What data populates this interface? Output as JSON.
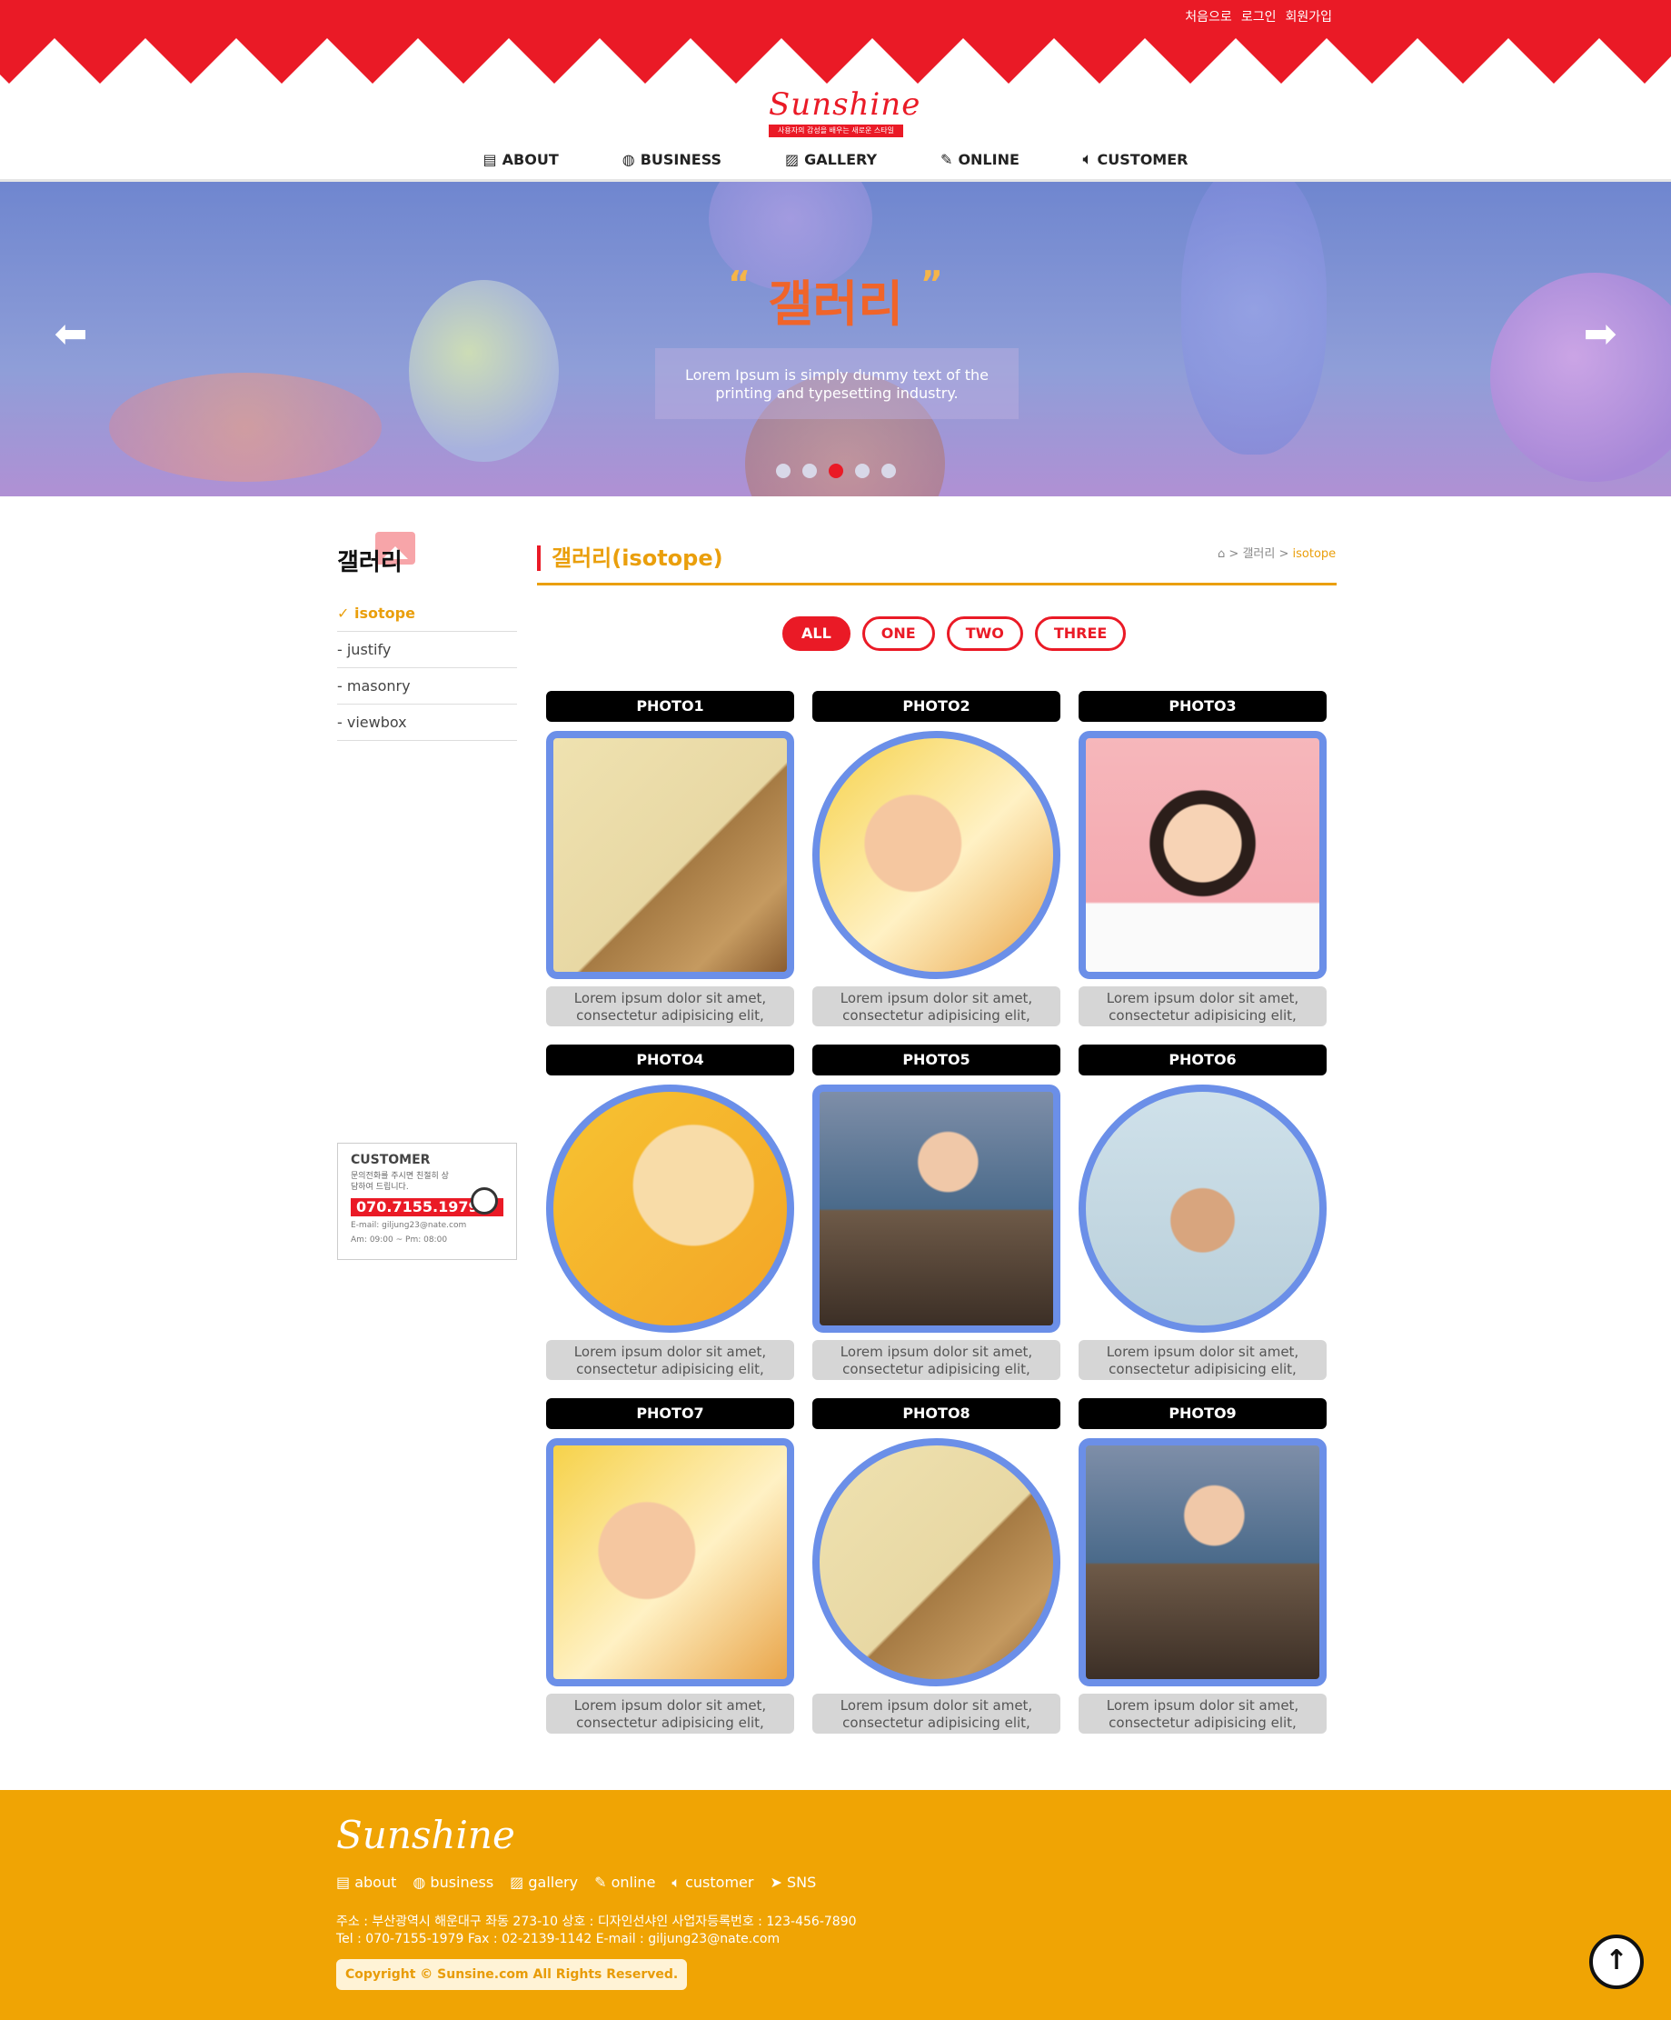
{
  "header": {
    "top_links": [
      "처음으로",
      "로그인",
      "회원가입"
    ],
    "logo_text": "Sunshine",
    "logo_tagline": "사용자의 감성을 배우는 새로운 스타일",
    "nav": [
      {
        "label": "ABOUT",
        "icon": "building-icon"
      },
      {
        "label": "BUSINESS",
        "icon": "globe-icon"
      },
      {
        "label": "GALLERY",
        "icon": "image-icon"
      },
      {
        "label": "ONLINE",
        "icon": "edit-icon"
      },
      {
        "label": "CUSTOMER",
        "icon": "speaker-icon"
      }
    ],
    "brand_color": "#ea1a26"
  },
  "hero": {
    "title": "갤러리",
    "text": "Lorem Ipsum is simply dummy text of the printing and typesetting industry.",
    "slide_count": 5,
    "active_slide": 3
  },
  "sidebar": {
    "title": "갤러리",
    "items": [
      "✓ isotope",
      "- justify",
      "- masonry",
      "- viewbox"
    ],
    "active_index": 0,
    "customer": {
      "title": "CUSTOMER",
      "desc": "문의전화를 주시면 친절히 상담하여 드립니다.",
      "phone": "070.7155.1979",
      "email": "E-mail: giljung23@nate.com",
      "hours": "Am: 09:00 ~ Pm: 08:00"
    }
  },
  "content": {
    "title": "갤러리(isotope)",
    "breadcrumb": {
      "separator": ">",
      "section": "갤러리",
      "current": "isotope"
    },
    "filters": [
      "ALL",
      "ONE",
      "TWO",
      "THREE"
    ],
    "active_filter": 0,
    "accent_color": "#ea9f0c",
    "gallery": [
      {
        "title": "PHOTO1",
        "desc": "Lorem ipsum dolor sit amet, consectetur adipisicing elit,"
      },
      {
        "title": "PHOTO2",
        "desc": "Lorem ipsum dolor sit amet, consectetur adipisicing elit,"
      },
      {
        "title": "PHOTO3",
        "desc": "Lorem ipsum dolor sit amet, consectetur adipisicing elit,"
      },
      {
        "title": "PHOTO4",
        "desc": "Lorem ipsum dolor sit amet, consectetur adipisicing elit,"
      },
      {
        "title": "PHOTO5",
        "desc": "Lorem ipsum dolor sit amet, consectetur adipisicing elit,"
      },
      {
        "title": "PHOTO6",
        "desc": "Lorem ipsum dolor sit amet, consectetur adipisicing elit,"
      },
      {
        "title": "PHOTO7",
        "desc": "Lorem ipsum dolor sit amet, consectetur adipisicing elit,"
      },
      {
        "title": "PHOTO8",
        "desc": "Lorem ipsum dolor sit amet, consectetur adipisicing elit,"
      },
      {
        "title": "PHOTO9",
        "desc": "Lorem ipsum dolor sit amet, consectetur adipisicing elit,"
      }
    ]
  },
  "footer": {
    "logo_text": "Sunshine",
    "menu": [
      "about",
      "business",
      "gallery",
      "online",
      "customer",
      "SNS"
    ],
    "address": "주소 : 부산광역시 해운대구 좌동 273-10    상호 : 디자인선샤인    사업자등록번호 : 123-456-7890",
    "contact": "Tel : 070-7155-1979    Fax : 02-2139-1142    E-mail : giljung23@nate.com",
    "copyright": "Copyright © Sunsine.com All Rights Reserved.",
    "background_color": "#f0a404"
  }
}
